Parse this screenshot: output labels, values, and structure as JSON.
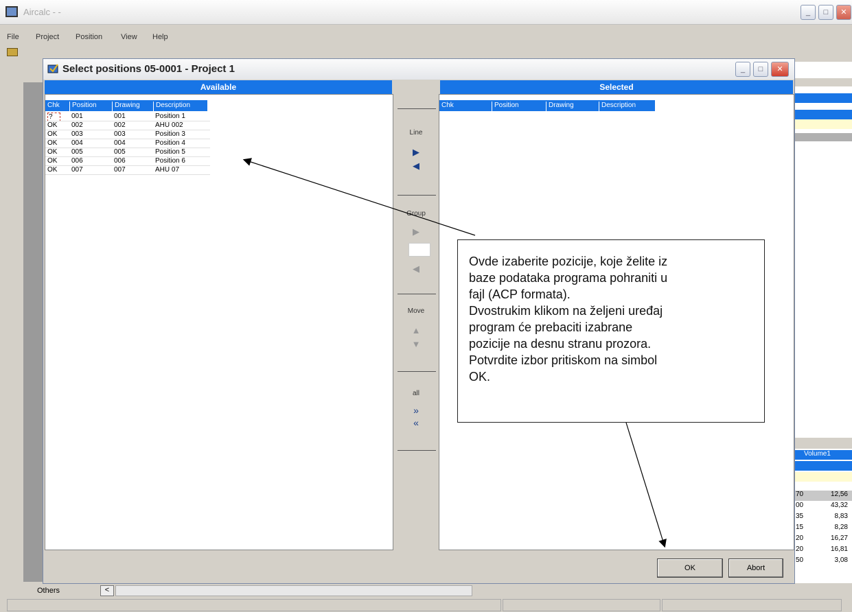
{
  "app": {
    "title": "Aircalc - -"
  },
  "menu": [
    "File",
    "Project",
    "Position",
    "View",
    "Help"
  ],
  "dialog": {
    "title": "Select positions  05-0001 - Project 1",
    "available_header": "Available",
    "selected_header": "Selected",
    "columns": [
      "Chk",
      "Position",
      "Drawing",
      "Description"
    ],
    "rows": [
      {
        "chk": "?",
        "position": "001",
        "drawing": "001",
        "description": "Position 1"
      },
      {
        "chk": "OK",
        "position": "002",
        "drawing": "002",
        "description": "AHU 002"
      },
      {
        "chk": "OK",
        "position": "003",
        "drawing": "003",
        "description": "Position 3"
      },
      {
        "chk": "OK",
        "position": "004",
        "drawing": "004",
        "description": "Position 4"
      },
      {
        "chk": "OK",
        "position": "005",
        "drawing": "005",
        "description": "Position 5"
      },
      {
        "chk": "OK",
        "position": "006",
        "drawing": "006",
        "description": "Position 6"
      },
      {
        "chk": "OK",
        "position": "007",
        "drawing": "007",
        "description": "AHU 07"
      }
    ],
    "middle": {
      "line": "Line",
      "group": "Group",
      "move": "Move",
      "all": "all"
    },
    "ok_label": "OK",
    "abort_label": "Abort"
  },
  "callout": {
    "lines": [
      "Ovde izaberite pozicije, koje želite iz",
      "baze podataka programa pohraniti u",
      "fajl (ACP formata).",
      "Dvostrukim klikom na željeni uređaj",
      "program će prebaciti izabrane",
      "pozicije na desnu stranu prozora.",
      "Potvrdite izbor pritiskom na simbol",
      "OK."
    ]
  },
  "background_right": {
    "header": "Volume1",
    "rows": [
      {
        "a": "70",
        "b": "12,56"
      },
      {
        "a": "00",
        "b": "43,32"
      },
      {
        "a": "35",
        "b": "8,83"
      },
      {
        "a": "15",
        "b": "8,28"
      },
      {
        "a": "20",
        "b": "16,27"
      },
      {
        "a": "20",
        "b": "16,81"
      },
      {
        "a": "50",
        "b": "3,08"
      }
    ]
  },
  "statusbar": {
    "tab": "Others"
  },
  "colors": {
    "header_blue": "#1875e6",
    "dialog_bg": "#d4d0c8"
  },
  "icons": [
    "app-icon",
    "dialog-icon",
    "minimize-icon",
    "maximize-icon",
    "close-icon",
    "arrow-right-icon",
    "arrow-left-icon",
    "arrow-up-icon",
    "arrow-down-icon",
    "double-arrow-right-icon",
    "double-arrow-left-icon"
  ]
}
